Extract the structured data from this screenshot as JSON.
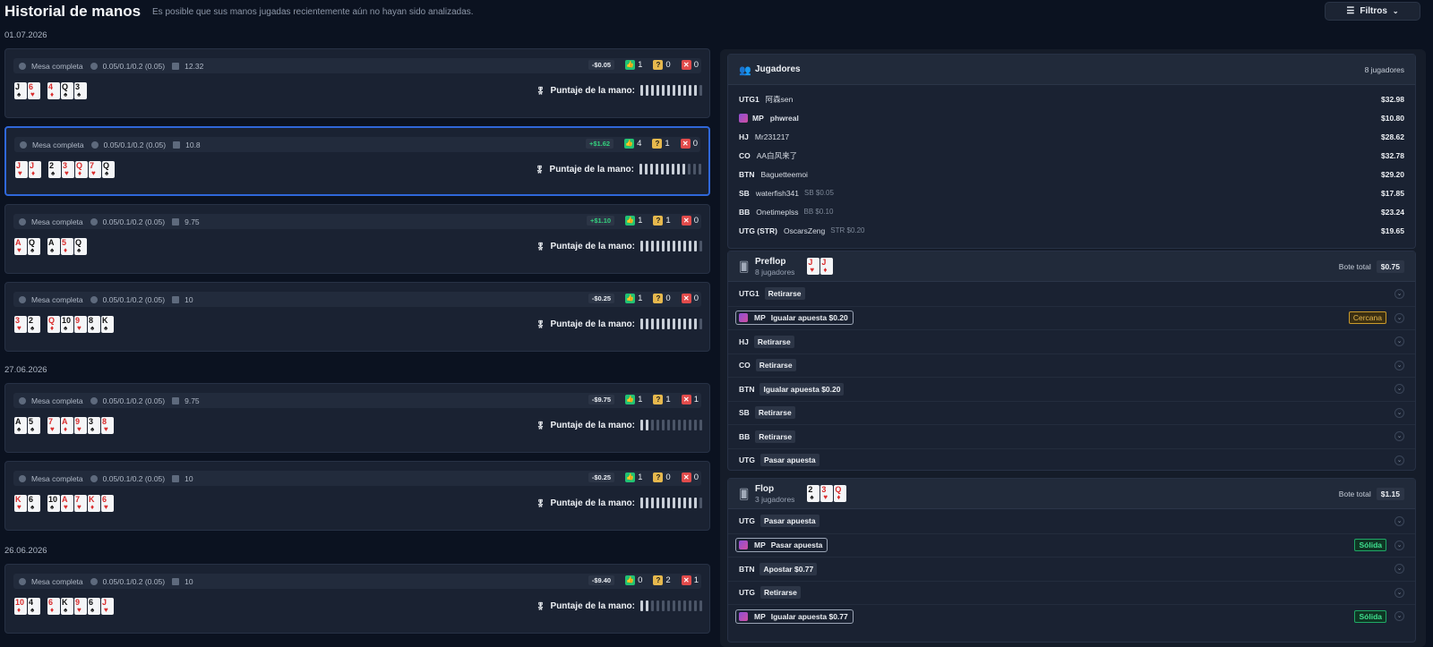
{
  "header": {
    "title": "Historial de manos",
    "subtitle": "Es posible que sus manos jugadas recientemente aún no hayan sido analizadas.",
    "filter_label": "Filtros"
  },
  "score_label": "Puntaje de la mano:",
  "dates": [
    "01.07.2026",
    "27.06.2026",
    "26.06.2026"
  ],
  "hands": [
    {
      "table": "Mesa completa",
      "stakes": "0.05/0.1/0.2 (0.05)",
      "pot": "12.32",
      "result": "-$0.05",
      "good": "1",
      "doubt": "0",
      "bad": "0",
      "score": 0.9,
      "cards": [
        [
          "J",
          "♠",
          "blk"
        ],
        [
          "6",
          "♥",
          "red"
        ],
        [
          "4",
          "♦",
          "red"
        ],
        [
          "Q",
          "♠",
          "blk"
        ],
        [
          "3",
          "♠",
          "blk"
        ]
      ],
      "gap_after": 2
    },
    {
      "table": "Mesa completa",
      "stakes": "0.05/0.1/0.2 (0.05)",
      "pot": "10.8",
      "result": "+$1.62",
      "good": "4",
      "doubt": "1",
      "bad": "0",
      "score": 0.75,
      "cards": [
        [
          "J",
          "♥",
          "red"
        ],
        [
          "J",
          "♦",
          "red"
        ],
        [
          "2",
          "♠",
          "blk"
        ],
        [
          "3",
          "♥",
          "red"
        ],
        [
          "Q",
          "♦",
          "red"
        ],
        [
          "7",
          "♥",
          "red"
        ],
        [
          "Q",
          "♠",
          "blk"
        ]
      ],
      "gap_after": 2
    },
    {
      "table": "Mesa completa",
      "stakes": "0.05/0.1/0.2 (0.05)",
      "pot": "9.75",
      "result": "+$1.10",
      "good": "1",
      "doubt": "1",
      "bad": "0",
      "score": 0.9,
      "cards": [
        [
          "A",
          "♥",
          "red"
        ],
        [
          "Q",
          "♠",
          "blk"
        ],
        [
          "A",
          "♠",
          "blk"
        ],
        [
          "5",
          "♦",
          "red"
        ],
        [
          "Q",
          "♠",
          "blk"
        ]
      ],
      "gap_after": 2
    },
    {
      "table": "Mesa completa",
      "stakes": "0.05/0.1/0.2 (0.05)",
      "pot": "10",
      "result": "-$0.25",
      "good": "1",
      "doubt": "0",
      "bad": "0",
      "score": 0.9,
      "cards": [
        [
          "3",
          "♥",
          "red"
        ],
        [
          "2",
          "♠",
          "blk"
        ],
        [
          "Q",
          "♦",
          "red"
        ],
        [
          "10",
          "♠",
          "blk"
        ],
        [
          "9",
          "♥",
          "red"
        ],
        [
          "8",
          "♠",
          "blk"
        ],
        [
          "K",
          "♠",
          "blk"
        ]
      ],
      "gap_after": 2
    },
    {
      "table": "Mesa completa",
      "stakes": "0.05/0.1/0.2 (0.05)",
      "pot": "9.75",
      "result": "-$9.75",
      "good": "1",
      "doubt": "1",
      "bad": "1",
      "score": 0.2,
      "cards": [
        [
          "A",
          "♠",
          "blk"
        ],
        [
          "5",
          "♠",
          "blk"
        ],
        [
          "7",
          "♥",
          "red"
        ],
        [
          "A",
          "♦",
          "red"
        ],
        [
          "9",
          "♥",
          "red"
        ],
        [
          "3",
          "♠",
          "blk"
        ],
        [
          "8",
          "♥",
          "red"
        ]
      ],
      "gap_after": 2
    },
    {
      "table": "Mesa completa",
      "stakes": "0.05/0.1/0.2 (0.05)",
      "pot": "10",
      "result": "-$0.25",
      "good": "1",
      "doubt": "0",
      "bad": "0",
      "score": 0.9,
      "cards": [
        [
          "K",
          "♥",
          "red"
        ],
        [
          "6",
          "♠",
          "blk"
        ],
        [
          "10",
          "♠",
          "blk"
        ],
        [
          "A",
          "♥",
          "red"
        ],
        [
          "7",
          "♥",
          "red"
        ],
        [
          "K",
          "♦",
          "red"
        ],
        [
          "6",
          "♥",
          "red"
        ]
      ],
      "gap_after": 2
    },
    {
      "table": "Mesa completa",
      "stakes": "0.05/0.1/0.2 (0.05)",
      "pot": "10",
      "result": "-$9.40",
      "good": "0",
      "doubt": "2",
      "bad": "1",
      "score": 0.2,
      "cards": [
        [
          "10",
          "♦",
          "red"
        ],
        [
          "4",
          "♠",
          "blk"
        ],
        [
          "6",
          "♦",
          "red"
        ],
        [
          "K",
          "♠",
          "blk"
        ],
        [
          "9",
          "♥",
          "red"
        ],
        [
          "6",
          "♠",
          "blk"
        ],
        [
          "J",
          "♥",
          "red"
        ]
      ],
      "gap_after": 2
    }
  ],
  "players": {
    "title": "Jugadores",
    "count": "8 jugadores",
    "rows": [
      {
        "pos": "UTG1",
        "name": "阿森sen",
        "sub": "",
        "stack": "$32.98",
        "hero": false
      },
      {
        "pos": "MP",
        "name": "phwreal",
        "sub": "",
        "stack": "$10.80",
        "hero": true
      },
      {
        "pos": "HJ",
        "name": "Mr231217",
        "sub": "",
        "stack": "$28.62",
        "hero": false
      },
      {
        "pos": "CO",
        "name": "AA白风来了",
        "sub": "",
        "stack": "$32.78",
        "hero": false
      },
      {
        "pos": "BTN",
        "name": "Baguetteemoi",
        "sub": "",
        "stack": "$29.20",
        "hero": false
      },
      {
        "pos": "SB",
        "name": "waterfish341",
        "sub": "SB $0.05",
        "stack": "$17.85",
        "hero": false
      },
      {
        "pos": "BB",
        "name": "Onetimeplss",
        "sub": "BB $0.10",
        "stack": "$23.24",
        "hero": false
      },
      {
        "pos": "UTG (STR)",
        "name": "OscarsZeng",
        "sub": "STR $0.20",
        "stack": "$19.65",
        "hero": false
      }
    ]
  },
  "pot_label": "Bote total",
  "preflop": {
    "title": "Preflop",
    "players": "8 jugadores",
    "pot": "$0.75",
    "cards": [
      [
        "J",
        "♥",
        "red"
      ],
      [
        "J",
        "♦",
        "red"
      ]
    ],
    "actions": [
      {
        "pos": "UTG1",
        "action": "Retirarse",
        "hero": false,
        "badge": ""
      },
      {
        "pos": "MP",
        "action": "Igualar apuesta $0.20",
        "hero": true,
        "badge": "Cercana"
      },
      {
        "pos": "HJ",
        "action": "Retirarse",
        "hero": false,
        "badge": ""
      },
      {
        "pos": "CO",
        "action": "Retirarse",
        "hero": false,
        "badge": ""
      },
      {
        "pos": "BTN",
        "action": "Igualar apuesta $0.20",
        "hero": false,
        "badge": ""
      },
      {
        "pos": "SB",
        "action": "Retirarse",
        "hero": false,
        "badge": ""
      },
      {
        "pos": "BB",
        "action": "Retirarse",
        "hero": false,
        "badge": ""
      },
      {
        "pos": "UTG",
        "action": "Pasar apuesta",
        "hero": false,
        "badge": ""
      }
    ]
  },
  "flop": {
    "title": "Flop",
    "players": "3 jugadores",
    "pot": "$1.15",
    "cards": [
      [
        "2",
        "♠",
        "blk"
      ],
      [
        "3",
        "♥",
        "red"
      ],
      [
        "Q",
        "♦",
        "red"
      ]
    ],
    "actions": [
      {
        "pos": "UTG",
        "action": "Pasar apuesta",
        "hero": false,
        "badge": ""
      },
      {
        "pos": "MP",
        "action": "Pasar apuesta",
        "hero": true,
        "badge": "Sólida"
      },
      {
        "pos": "BTN",
        "action": "Apostar $0.77",
        "hero": false,
        "badge": ""
      },
      {
        "pos": "UTG",
        "action": "Retirarse",
        "hero": false,
        "badge": ""
      },
      {
        "pos": "MP",
        "action": "Igualar apuesta $0.77",
        "hero": true,
        "badge": "Sólida"
      }
    ]
  }
}
